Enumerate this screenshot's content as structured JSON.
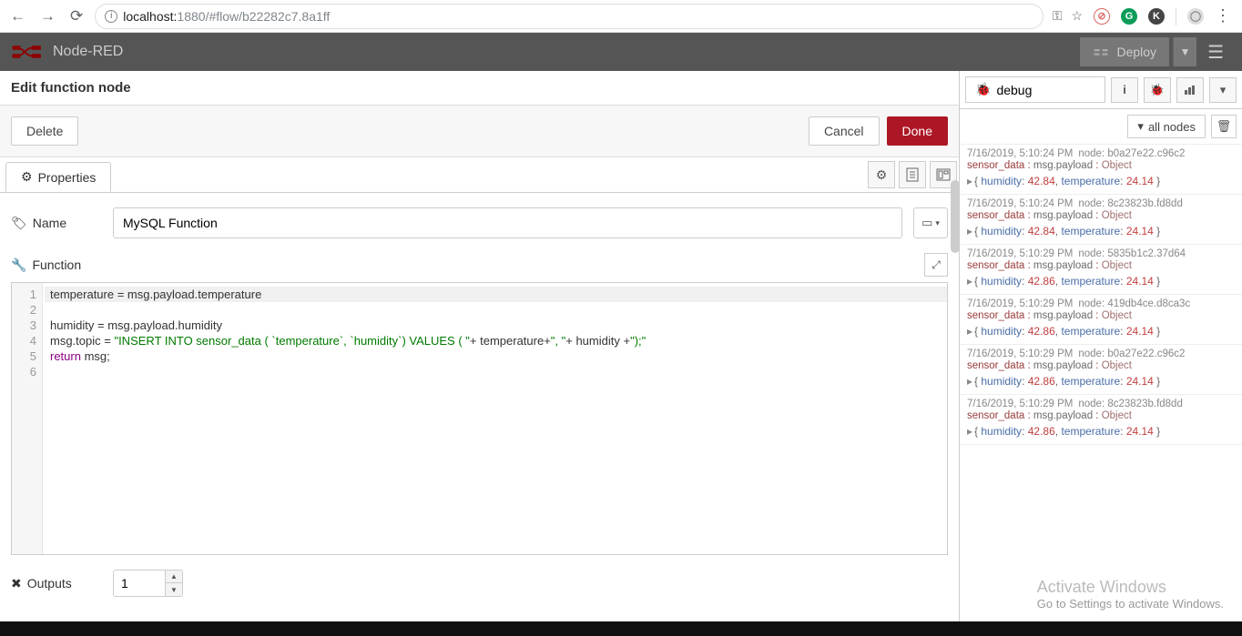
{
  "browser": {
    "url_host": "localhost:",
    "url_port": "1880",
    "url_path": "/#flow/b22282c7.8a1ff"
  },
  "header": {
    "brand": "Node-RED",
    "deploy": "Deploy"
  },
  "tray": {
    "title": "Edit function node",
    "delete": "Delete",
    "cancel": "Cancel",
    "done": "Done"
  },
  "properties": {
    "tab_label": "Properties",
    "name_label": "Name",
    "name_value": "MySQL Function",
    "function_label": "Function",
    "outputs_label": "Outputs",
    "outputs_value": "1"
  },
  "code": {
    "lines": [
      "temperature = msg.payload.temperature",
      "humidity = msg.payload.humidity",
      "msg.topic = \"INSERT INTO sensor_data ( `temperature`, `humidity`) VALUES ( \"+ temperature+\", \"+ humidity +\");\"",
      "return msg;",
      "",
      ""
    ]
  },
  "sidepanel": {
    "tab": "debug",
    "filter": "all nodes"
  },
  "debug": [
    {
      "ts": "7/16/2019, 5:10:24 PM",
      "node": "b0a27e22.c96c2",
      "topic": "sensor_data",
      "path": "msg.payload",
      "type": "Object",
      "humidity": "42.84",
      "temperature": "24.14"
    },
    {
      "ts": "7/16/2019, 5:10:24 PM",
      "node": "8c23823b.fd8dd",
      "topic": "sensor_data",
      "path": "msg.payload",
      "type": "Object",
      "humidity": "42.84",
      "temperature": "24.14"
    },
    {
      "ts": "7/16/2019, 5:10:29 PM",
      "node": "5835b1c2.37d64",
      "topic": "sensor_data",
      "path": "msg.payload",
      "type": "Object",
      "humidity": "42.86",
      "temperature": "24.14"
    },
    {
      "ts": "7/16/2019, 5:10:29 PM",
      "node": "419db4ce.d8ca3c",
      "topic": "sensor_data",
      "path": "msg.payload",
      "type": "Object",
      "humidity": "42.86",
      "temperature": "24.14"
    },
    {
      "ts": "7/16/2019, 5:10:29 PM",
      "node": "b0a27e22.c96c2",
      "topic": "sensor_data",
      "path": "msg.payload",
      "type": "Object",
      "humidity": "42.86",
      "temperature": "24.14"
    },
    {
      "ts": "7/16/2019, 5:10:29 PM",
      "node": "8c23823b.fd8dd",
      "topic": "sensor_data",
      "path": "msg.payload",
      "type": "Object",
      "humidity": "42.86",
      "temperature": "24.14"
    }
  ],
  "watermark": {
    "l1": "Activate Windows",
    "l2": "Go to Settings to activate Windows."
  }
}
